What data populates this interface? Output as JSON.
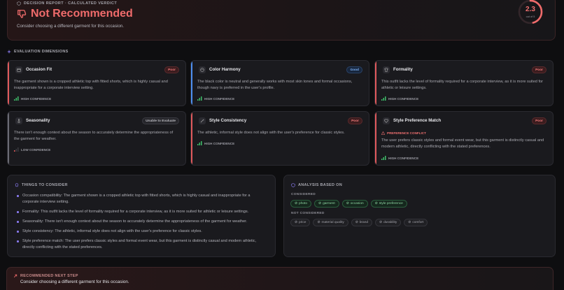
{
  "verdict": {
    "eyebrow": "DECISION REPORT · CALCULATED VERDICT",
    "title": "Not Recommended",
    "subtitle": "Consider choosing a different garment for this occasion.",
    "score": "2.3",
    "score_of": "out of 5",
    "score_fraction": 0.46,
    "accent": "#ef6b6b"
  },
  "dimensions": {
    "label": "EVALUATION DIMENSIONS",
    "cards": [
      {
        "name": "Occasion Fit",
        "badge": "Poor",
        "status": "poor",
        "icon": "calendar-icon",
        "body": "The garment shown is a cropped athletic top with fitted shorts, which is highly casual and inappropriate for a corporate interview setting.",
        "confidence": "HIGH CONFIDENCE"
      },
      {
        "name": "Color Harmony",
        "badge": "Good",
        "status": "good",
        "icon": "palette-icon",
        "body": "The black color is neutral and generally works with most skin tones and formal occasions, though navy is preferred in the user's profile.",
        "confidence": "HIGH CONFIDENCE"
      },
      {
        "name": "Formality",
        "badge": "Poor",
        "status": "poor",
        "icon": "shirt-icon",
        "body": "This outfit lacks the level of formality required for a corporate interview, as it is more suited for athletic or leisure settings.",
        "confidence": "HIGH CONFIDENCE"
      },
      {
        "name": "Seasonality",
        "badge": "Unable to Evaluate",
        "status": "unable",
        "icon": "thermometer-icon",
        "body": "There isn't enough context about the season to accurately determine the appropriateness of the garment for weather.",
        "confidence": "LOW CONFIDENCE"
      },
      {
        "name": "Style Consistency",
        "badge": "Poor",
        "status": "poor",
        "icon": "wand-icon",
        "body": "The athletic, informal style does not align with the user's preference for classic styles.",
        "confidence": "HIGH CONFIDENCE"
      },
      {
        "name": "Style Preference Match",
        "badge": "Poor",
        "status": "poor",
        "icon": "heart-icon",
        "conflict": "PREFERENCE CONFLICT",
        "body": "The user prefers classic styles and formal event wear, but this garment is distinctly casual and modern athletic, directly conflicting with the stated preferences.",
        "confidence": "HIGH CONFIDENCE"
      }
    ]
  },
  "consider": {
    "label": "THINGS TO CONSIDER",
    "items": [
      "Occasion compatibility: The garment shown is a cropped athletic top with fitted shorts, which is highly casual and inappropriate for a corporate interview setting.",
      "Formality: This outfit lacks the level of formality required for a corporate interview, as it is more suited for athletic or leisure settings.",
      "Seasonality: There isn't enough context about the season to accurately determine the appropriateness of the garment for weather.",
      "Style consistency: The athletic, informal style does not align with the user's preference for classic styles.",
      "Style preference match: The user prefers classic styles and formal event wear, but this garment is distinctly casual and modern athletic, directly conflicting with the stated preferences."
    ]
  },
  "analysis": {
    "label": "ANALYSIS BASED ON",
    "considered_label": "CONSIDERED",
    "considered": [
      "photo",
      "garment",
      "occasion",
      "style preference"
    ],
    "not_considered_label": "NOT CONSIDERED",
    "not_considered": [
      "price",
      "material quality",
      "brand",
      "durability",
      "comfort"
    ]
  },
  "next_step": {
    "label": "RECOMMENDED NEXT STEP",
    "text": "Consider choosing a different garment for this occasion."
  },
  "colors": {
    "poor": "#e0595b",
    "good": "#4d8ff0",
    "unable": "#6b6b74",
    "high_conf": "#3fbf6a",
    "low_conf": "#e0595b"
  }
}
